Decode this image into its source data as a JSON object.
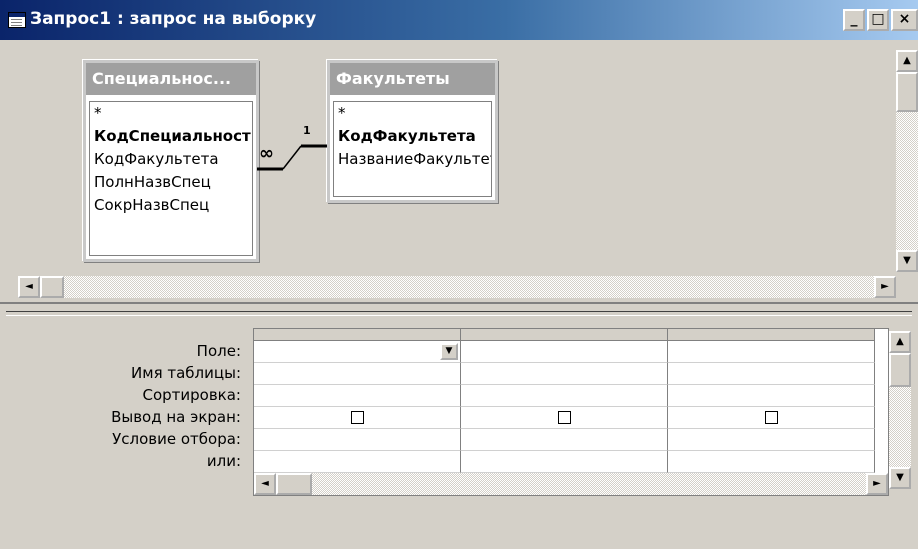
{
  "window": {
    "title": "Запрос1 : запрос на выборку",
    "icon": "query-icon",
    "buttons": {
      "minimize": "_",
      "maximize": "□",
      "close": "×"
    }
  },
  "tables": [
    {
      "title": "Специальнос...",
      "fields": [
        {
          "name": "*",
          "key": false
        },
        {
          "name": "КодСпециальность",
          "key": true
        },
        {
          "name": "КодФакультета",
          "key": false
        },
        {
          "name": "ПолнНазвСпец",
          "key": false
        },
        {
          "name": "СокрНазвСпец",
          "key": false
        }
      ]
    },
    {
      "title": "Факультеты",
      "fields": [
        {
          "name": "*",
          "key": false
        },
        {
          "name": "КодФакультета",
          "key": true
        },
        {
          "name": "НазваниеФакультета",
          "key": false
        }
      ]
    }
  ],
  "relationship": {
    "many_symbol": "∞",
    "one_symbol": "1"
  },
  "design_grid": {
    "row_labels": [
      "Поле:",
      "Имя таблицы:",
      "Сортировка:",
      "Вывод на экран:",
      "Условие отбора:",
      "или:"
    ],
    "columns": [
      {
        "field": "",
        "table": "",
        "sort": "",
        "show": false,
        "criteria": "",
        "or": "",
        "has_dropdown": true
      },
      {
        "field": "",
        "table": "",
        "sort": "",
        "show": false,
        "criteria": "",
        "or": "",
        "has_dropdown": false
      },
      {
        "field": "",
        "table": "",
        "sort": "",
        "show": false,
        "criteria": "",
        "or": "",
        "has_dropdown": false
      }
    ]
  },
  "scroll_icons": {
    "up": "▲",
    "down": "▼",
    "left": "◄",
    "right": "►"
  },
  "colors": {
    "title_start": "#0a246a",
    "title_end": "#a6caf0",
    "face": "#d4d0c8",
    "table_header": "#a0a0a0"
  }
}
